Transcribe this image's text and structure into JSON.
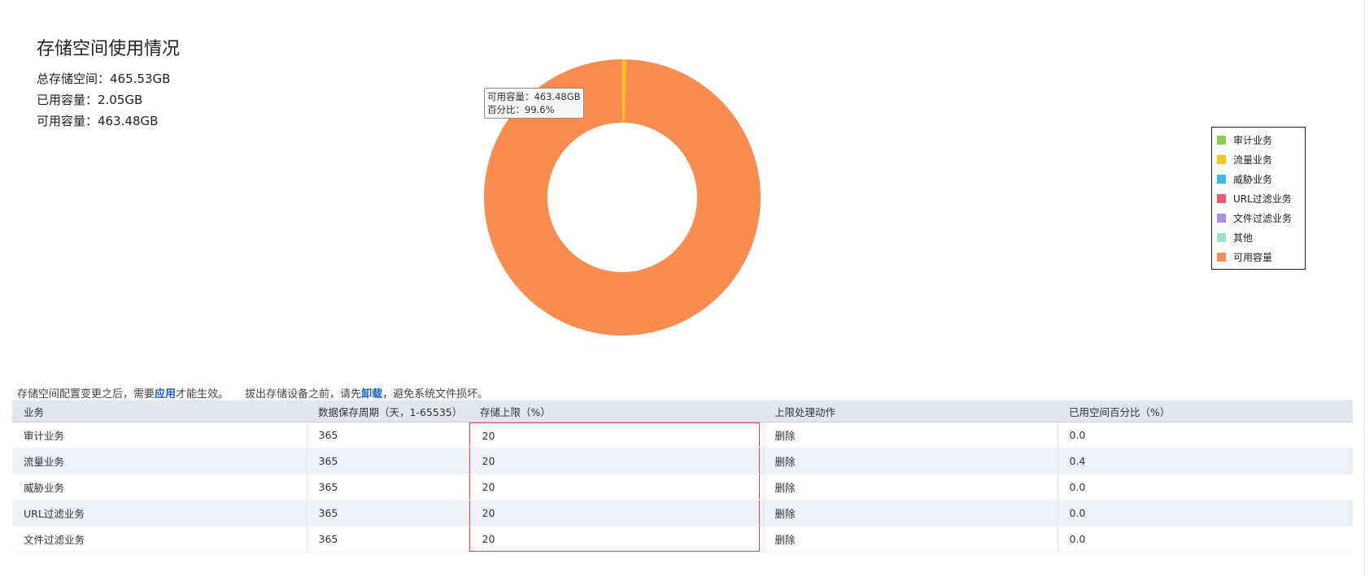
{
  "summary": {
    "title": "存储空间使用情况",
    "total": "总存储空间：465.53GB",
    "used": "已用容量：2.05GB",
    "available": "可用容量：463.48GB"
  },
  "tooltip": {
    "line1": "可用容量：463.48GB",
    "line2": "百分比：99.6%"
  },
  "chart_data": {
    "type": "pie",
    "style": "donut",
    "unit": "GB",
    "categories": [
      "审计业务",
      "流量业务",
      "威胁业务",
      "URL过滤业务",
      "文件过滤业务",
      "其他",
      "可用容量"
    ],
    "values": [
      0.0,
      2.05,
      0.0,
      0.0,
      0.0,
      0.0,
      463.48
    ],
    "colors": [
      "#8fce4a",
      "#f5c518",
      "#3fb8f0",
      "#f0566e",
      "#a98be8",
      "#9fe3c4",
      "#f98c50"
    ],
    "legend_position": "right"
  },
  "legend": {
    "items": [
      {
        "label": "审计业务",
        "color": "#8fce4a"
      },
      {
        "label": "流量业务",
        "color": "#f5c518"
      },
      {
        "label": "威胁业务",
        "color": "#3fb8f0"
      },
      {
        "label": "URL过滤业务",
        "color": "#f0566e"
      },
      {
        "label": "文件过滤业务",
        "color": "#a98be8"
      },
      {
        "label": "其他",
        "color": "#9fe3c4"
      },
      {
        "label": "可用容量",
        "color": "#f98c50"
      }
    ]
  },
  "notice": {
    "part1": "存储空间配置变更之后，需要",
    "apply_link": "应用",
    "part2": "才能生效。",
    "part3": "拔出存储设备之前，请先",
    "unmount_link": "卸载",
    "part4": "，避免系统文件损坏。"
  },
  "table": {
    "headers": {
      "service": "业务",
      "retention": "数据保存周期（天，1-65535）",
      "limit": "存储上限（%）",
      "action": "上限处理动作",
      "used_pct": "已用空间百分比（%）"
    },
    "rows": [
      {
        "service": "审计业务",
        "retention": "365",
        "limit": "20",
        "action": "删除",
        "used_pct": "0.0"
      },
      {
        "service": "流量业务",
        "retention": "365",
        "limit": "20",
        "action": "删除",
        "used_pct": "0.4"
      },
      {
        "service": "威胁业务",
        "retention": "365",
        "limit": "20",
        "action": "删除",
        "used_pct": "0.0"
      },
      {
        "service": "URL过滤业务",
        "retention": "365",
        "limit": "20",
        "action": "删除",
        "used_pct": "0.0"
      },
      {
        "service": "文件过滤业务",
        "retention": "365",
        "limit": "20",
        "action": "删除",
        "used_pct": "0.0"
      }
    ]
  }
}
